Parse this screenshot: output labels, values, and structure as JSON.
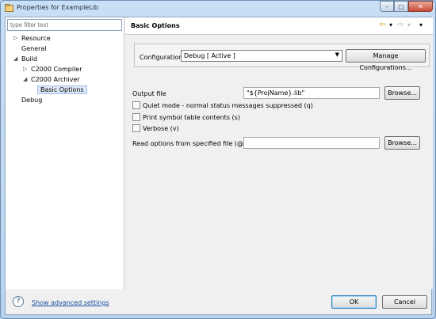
{
  "window": {
    "title": "Properties for ExampleLib",
    "min_glyph": "–",
    "max_glyph": "□",
    "close_glyph": "✕"
  },
  "filter": {
    "placeholder": "type filter text"
  },
  "tree": [
    {
      "label": "Resource",
      "expanded": false
    },
    {
      "label": "General"
    },
    {
      "label": "Build",
      "expanded": true
    },
    {
      "label": "C2000 Compiler",
      "expanded": false
    },
    {
      "label": "C2000 Archiver",
      "expanded": true
    },
    {
      "label": "Basic Options",
      "selected": true
    },
    {
      "label": "Debug"
    }
  ],
  "tree_arrows": {
    "collapsed": "▷",
    "expanded": "◢"
  },
  "page": {
    "title": "Basic Options"
  },
  "nav": {
    "back_icon": "⇦",
    "back_dd": "▾",
    "forward_icon": "⇨",
    "forward_dd": "▾",
    "menu": "▾"
  },
  "configuration": {
    "label": "Configuration:",
    "value": "Debug   [ Active ]",
    "dropdown": "▼",
    "button": "Manage Configurations..."
  },
  "output_file": {
    "label": "Output file",
    "value": "\"${ProjName}.lib\"",
    "button": "Browse..."
  },
  "options": [
    {
      "label": "Quiet mode - normal status messages suppressed (q)",
      "checked": false
    },
    {
      "label": "Print symbol table contents (s)",
      "checked": false
    },
    {
      "label": "Verbose (v)",
      "checked": false
    }
  ],
  "read_options": {
    "label": "Read options from specified file (@)",
    "value": "",
    "button": "Browse..."
  },
  "footer": {
    "help_glyph": "?",
    "advanced_link": "Show advanced settings",
    "ok": "OK",
    "cancel": "Cancel"
  },
  "colors": {
    "selection": "#dde9f8",
    "link": "#1a4fa3",
    "window_frame": "#bcd6ee"
  }
}
